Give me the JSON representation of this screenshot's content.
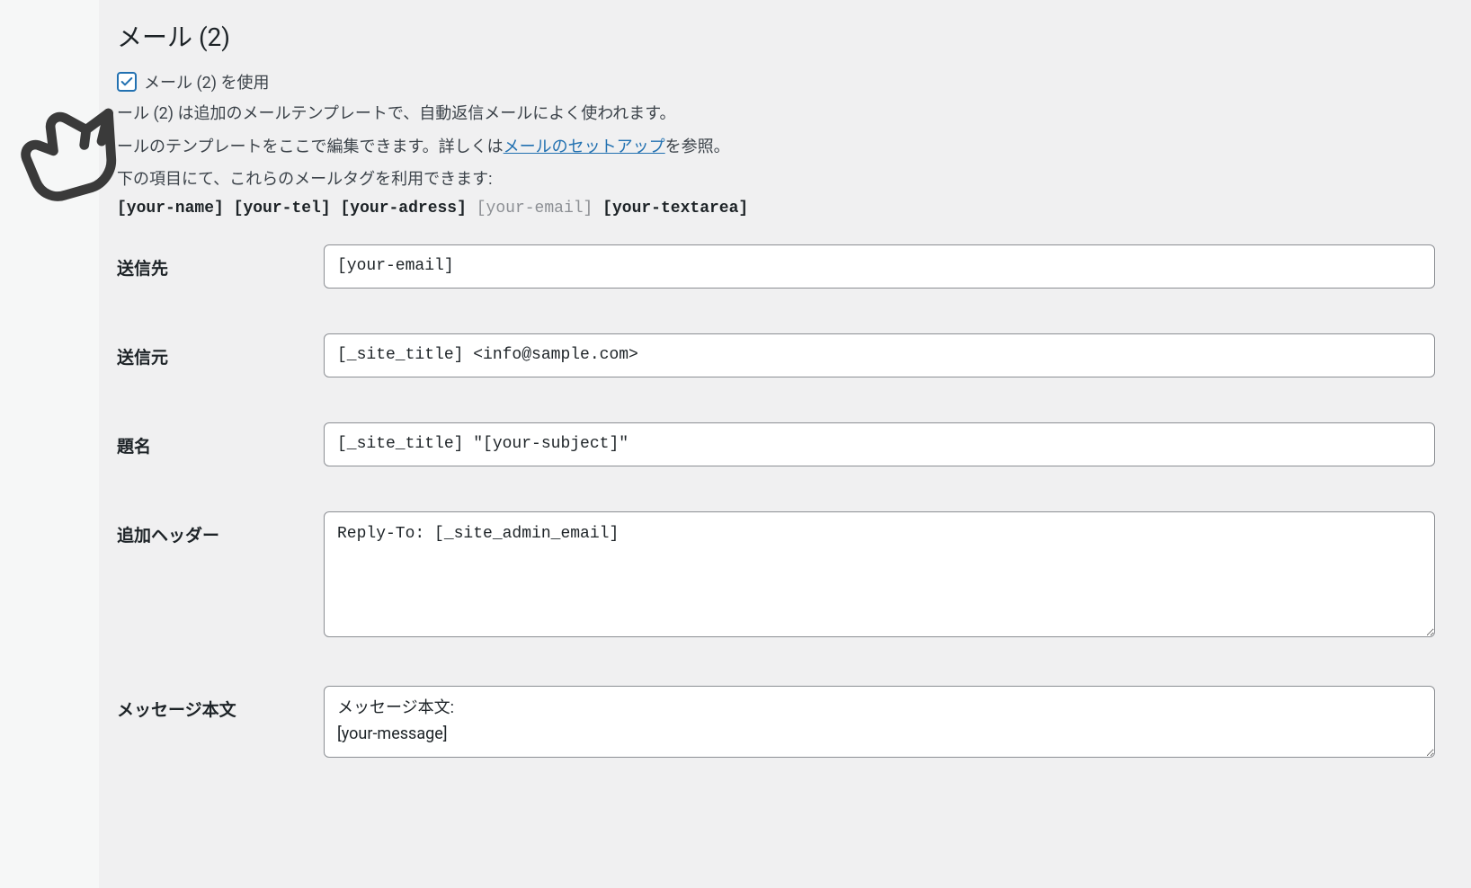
{
  "section": {
    "title": "メール (2)",
    "checkbox_label": "メール (2) を使用",
    "description1_prefix": "ール (2) は追加のメールテンプレートで、自動返信メールによく使われます。",
    "description2_prefix": "ールのテンプレートをここで編集できます。詳しくは",
    "description2_link": "メールのセットアップ",
    "description2_suffix": "を参照。",
    "description3": "下の項目にて、これらのメールタグを利用できます:",
    "mail_tags_bold_1": "[your-name]",
    "mail_tags_bold_2": "[your-tel]",
    "mail_tags_bold_3": "[your-adress]",
    "mail_tags_light": "[your-email]",
    "mail_tags_bold_4": "[your-textarea]"
  },
  "fields": {
    "to": {
      "label": "送信先",
      "value": "[your-email]"
    },
    "from": {
      "label": "送信元",
      "value": "[_site_title] <info@sample.com>"
    },
    "subject": {
      "label": "題名",
      "value": "[_site_title] \"[your-subject]\""
    },
    "headers": {
      "label": "追加ヘッダー",
      "value": "Reply-To: [_site_admin_email]"
    },
    "body": {
      "label": "メッセージ本文",
      "value": "メッセージ本文:\n[your-message]"
    }
  }
}
